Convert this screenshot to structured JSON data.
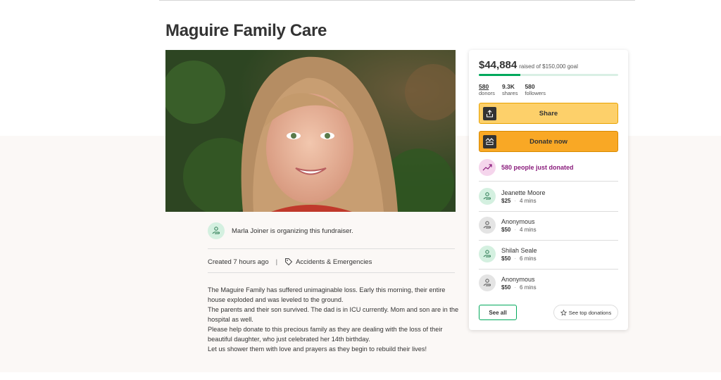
{
  "campaign": {
    "title": "Maguire Family Care",
    "organizer_text": "Marla Joiner is organizing this fundraiser.",
    "created": "Created 7 hours ago",
    "separator": "|",
    "category": "Accidents & Emergencies",
    "story": [
      "The Maguire Family has suffered unimaginable loss. Early this morning, their entire house exploded and was leveled to the ground.",
      "The parents and their son survived. The dad is in ICU currently. Mom and son are in the hospital as well.",
      "Please help donate to this precious family as they are dealing with the loss of their beautiful daughter, who just celebrated her 14th birthday.",
      "Let us shower them with love and prayers as they begin to rebuild their lives!"
    ]
  },
  "donation_card": {
    "amount": "$44,884",
    "goal_text": "raised of $150,000 goal",
    "progress_fraction": 0.3,
    "stats": [
      {
        "value": "580",
        "label": "donors"
      },
      {
        "value": "9.3K",
        "label": "shares"
      },
      {
        "value": "580",
        "label": "followers"
      }
    ],
    "share_label": "Share",
    "donate_label": "Donate now",
    "just_donated": "580 people just donated",
    "donations": [
      {
        "name": "Jeanette Moore",
        "amount": "$25",
        "time": "4 mins",
        "avatar": "green"
      },
      {
        "name": "Anonymous",
        "amount": "$50",
        "time": "4 mins",
        "avatar": "grey"
      },
      {
        "name": "Shilah Seale",
        "amount": "$50",
        "time": "6 mins",
        "avatar": "green"
      },
      {
        "name": "Anonymous",
        "amount": "$50",
        "time": "6 mins",
        "avatar": "grey"
      }
    ],
    "dot": "·",
    "see_all_label": "See all",
    "see_top_label": "See top donations"
  },
  "icons": {
    "share": "share-icon",
    "donate": "gofundme-logo-icon",
    "trend": "trending-up-icon",
    "tag": "tag-icon",
    "star": "star-icon",
    "donor": "donor-hand-icon"
  },
  "colors": {
    "accent_green": "#02a95c",
    "share_button": "#fdd06a",
    "donate_button": "#f9a825",
    "trend_text": "#8a1c7c"
  }
}
